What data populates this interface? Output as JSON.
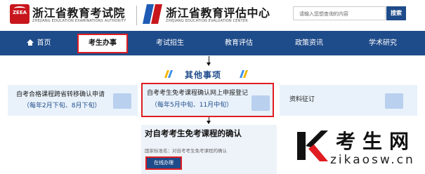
{
  "header": {
    "org1_logo_text": "ZEEA",
    "org1_name": "浙江省教育考试院",
    "org1_en": "ZHEJIANG EDUCATION EXAMINATIONS AUTHORITY",
    "org2_name": "浙江省教育评估中心",
    "org2_en": "ZHEJIANG EDUCATION EVALUATION CENTER",
    "search_placeholder": "请输入您想查询的内容",
    "search_button": "搜索"
  },
  "nav": {
    "items": [
      {
        "label": "首页"
      },
      {
        "label": "考生办事"
      },
      {
        "label": "考试招生"
      },
      {
        "label": "教育评估"
      },
      {
        "label": "政策资讯"
      },
      {
        "label": "学术研究"
      }
    ],
    "selected_index": 1
  },
  "section": {
    "title": "其他事项"
  },
  "cards": [
    {
      "title": "自考合格课程跨省转移确认申请",
      "sub": "（每年2月下旬、8月下旬）"
    },
    {
      "title": "自考考生免考课程确认网上申报登记",
      "sub": "（每年5月中旬、11月中旬）"
    },
    {
      "title": "资料征订",
      "sub": ""
    }
  ],
  "detail": {
    "title": "对自考考生免考课程的确认",
    "standard_name": "国家标准名：对自考考生免考课程的确认",
    "button": "在线办理"
  },
  "watermark": {
    "text": "考生网",
    "url": "zikaosw.cn"
  },
  "colors": {
    "nav_bg": "#1e4b8a",
    "highlight": "#e01d22",
    "card_bg": "#e9f2fb"
  }
}
